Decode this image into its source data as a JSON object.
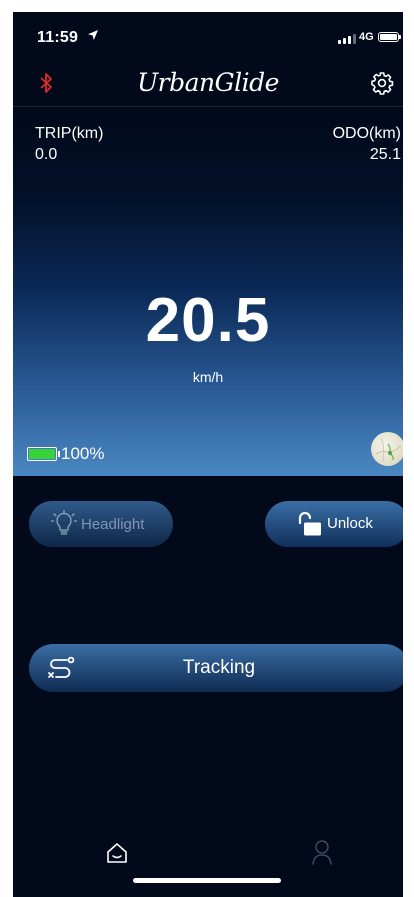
{
  "status_bar": {
    "time": "11:59",
    "network": "4G"
  },
  "header": {
    "app_title": "UrbanGlide",
    "bluetooth_color": "#e02b2b"
  },
  "stats": {
    "trip_label": "TRIP(km)",
    "trip_value": "0.0",
    "odo_label": "ODO(km)",
    "odo_value": "25.1"
  },
  "speed": {
    "value": "20.5",
    "unit": "km/h"
  },
  "battery": {
    "percent_text": "100%",
    "level": 1.0,
    "color": "#39d239"
  },
  "controls": {
    "headlight_label": "Headlight",
    "unlock_label": "Unlock",
    "tracking_label": "Tracking"
  },
  "tabs": {
    "home_icon": "home-icon",
    "profile_icon": "user-icon"
  }
}
